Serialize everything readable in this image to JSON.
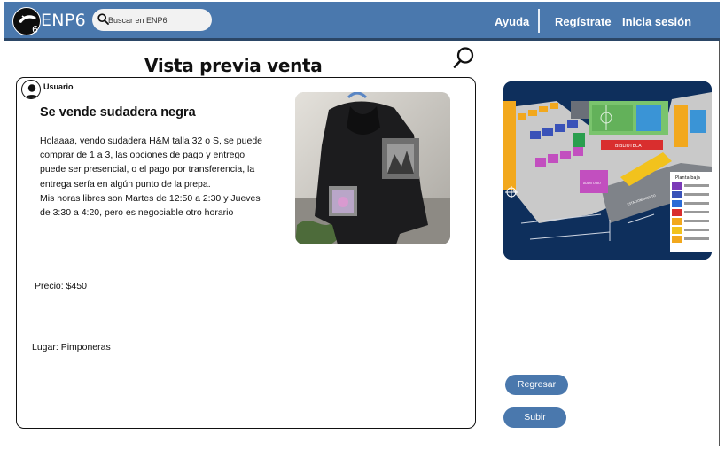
{
  "header": {
    "brand": "ENP6",
    "search_placeholder": "Buscar en ENP6",
    "nav": {
      "help": "Ayuda",
      "register": "Regístrate",
      "login": "Inicia sesión"
    }
  },
  "page": {
    "title": "Vista previa venta"
  },
  "post": {
    "user": "Usuario",
    "title": "Se vende sudadera negra",
    "description_lines": [
      "Holaaaa, vendo sudadera H&M talla 32 o S, se puede",
      "comprar de 1 a 3, las opciones de pago y entrego",
      "puede ser presencial, o el pago por transferencia, la",
      "entrega sería en algún punto de la prepa.",
      "Mis horas libres son Martes de 12:50 a 2:30 y Jueves",
      "de 3:30 a 4:20, pero es negociable otro horario"
    ],
    "price": "Precio: $450",
    "place": "Lugar: Pimponeras",
    "image": "black-hoodie-photo"
  },
  "map": {
    "library": "BIBLIOTECA",
    "legend_title": "Planta baja",
    "auditorium": "AUDITORIO",
    "parking": "ESTACIONAMIENTO"
  },
  "actions": {
    "back": "Regresar",
    "submit": "Subir"
  },
  "icons": {
    "search": "search-icon",
    "user": "user-avatar-icon",
    "logo": "school-logo"
  },
  "colors": {
    "header": "#4a78ad",
    "button": "#4a78ad",
    "map_bg": "#0e2f5c"
  }
}
